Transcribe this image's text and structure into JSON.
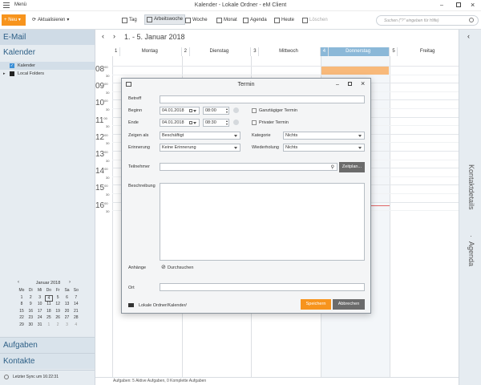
{
  "window": {
    "menu_label": "Menü",
    "title": "Kalender - Lokale Ordner - eM Client"
  },
  "toolbar": {
    "new_label": "Neu",
    "update_label": "Aktualisieren",
    "views": [
      {
        "label": "Tag",
        "icon": "day-view-icon"
      },
      {
        "label": "Arbeitswoche",
        "icon": "workweek-view-icon",
        "active": true
      },
      {
        "label": "Woche",
        "icon": "week-view-icon"
      },
      {
        "label": "Monat",
        "icon": "month-view-icon"
      },
      {
        "label": "Agenda",
        "icon": "agenda-view-icon"
      },
      {
        "label": "Heute",
        "icon": "today-icon"
      },
      {
        "label": "Löschen",
        "icon": "trash-icon"
      }
    ],
    "search_placeholder": "Suchen (\"?\" eingeben für Hilfe)"
  },
  "sidebar": {
    "email_label": "E-Mail",
    "calendar_label": "Kalender",
    "items": [
      {
        "label": "Kalender",
        "checked": true
      },
      {
        "label": "Local Folders",
        "checked": false
      }
    ],
    "tasks_label": "Aufgaben",
    "contacts_label": "Kontakte",
    "last_sync": "Letzter Sync um 16:22:31"
  },
  "mini_calendar": {
    "month": "Januar 2018",
    "weekdays": [
      "Mo",
      "Di",
      "Mi",
      "Do",
      "Fr",
      "Sa",
      "So"
    ],
    "weeks": [
      [
        "1",
        "2",
        "3",
        "4",
        "5",
        "6",
        "7"
      ],
      [
        "8",
        "9",
        "10",
        "11",
        "12",
        "13",
        "14"
      ],
      [
        "15",
        "16",
        "17",
        "18",
        "19",
        "20",
        "21"
      ],
      [
        "22",
        "23",
        "24",
        "25",
        "26",
        "27",
        "28"
      ],
      [
        "29",
        "30",
        "31",
        "1",
        "2",
        "3",
        "4"
      ]
    ],
    "today": "4"
  },
  "calendar": {
    "range": "1. - 5. Januar 2018",
    "days": [
      {
        "num": "1",
        "name": "Montag"
      },
      {
        "num": "2",
        "name": "Dienstag"
      },
      {
        "num": "3",
        "name": "Mittwoch"
      },
      {
        "num": "4",
        "name": "Donnerstag",
        "today": true
      },
      {
        "num": "5",
        "name": "Freitag"
      }
    ],
    "hours": [
      "08",
      "09",
      "10",
      "11",
      "12",
      "13",
      "14",
      "15",
      "16"
    ],
    "hour_suffix": "00",
    "half_suffix": "30"
  },
  "right_panel": {
    "contacts_label": "Kontaktdetails",
    "agenda_label": "Agenda"
  },
  "status": {
    "text": "Aufgaben: 5 Aktive Aufgaben, 0 Komplette Aufgaben"
  },
  "dialog": {
    "title": "Termin",
    "subject_label": "Betreff",
    "subject_value": "",
    "start_label": "Beginn",
    "start_date": "04.01.2018",
    "start_time": "08:00",
    "end_label": "Ende",
    "end_date": "04.01.2018",
    "end_time": "08:30",
    "allday_label": "Ganztägiger Termin",
    "private_label": "Privater Termin",
    "show_as_label": "Zeigen als",
    "show_as_value": "Beschäftigt",
    "category_label": "Kategorie",
    "category_value": "Nichts",
    "reminder_label": "Erinnerung",
    "reminder_value": "Keine Erinnerung",
    "repeat_label": "Wiederholung",
    "repeat_value": "Nichts",
    "attendees_label": "Teilnehmer",
    "schedule_button": "Zeitplan...",
    "description_label": "Beschreibung",
    "attachments_label": "Anhänge",
    "browse_label": "Durchsuchen",
    "location_label": "Ort",
    "folder_path": "Lokale Ordner/Kalender/",
    "save_button": "Speichern",
    "cancel_button": "Abbrechen"
  },
  "colors": {
    "accent": "#f7941d",
    "today_header": "#8bb8d8",
    "event": "#f8b97a",
    "cancel": "#6b6b6b"
  }
}
